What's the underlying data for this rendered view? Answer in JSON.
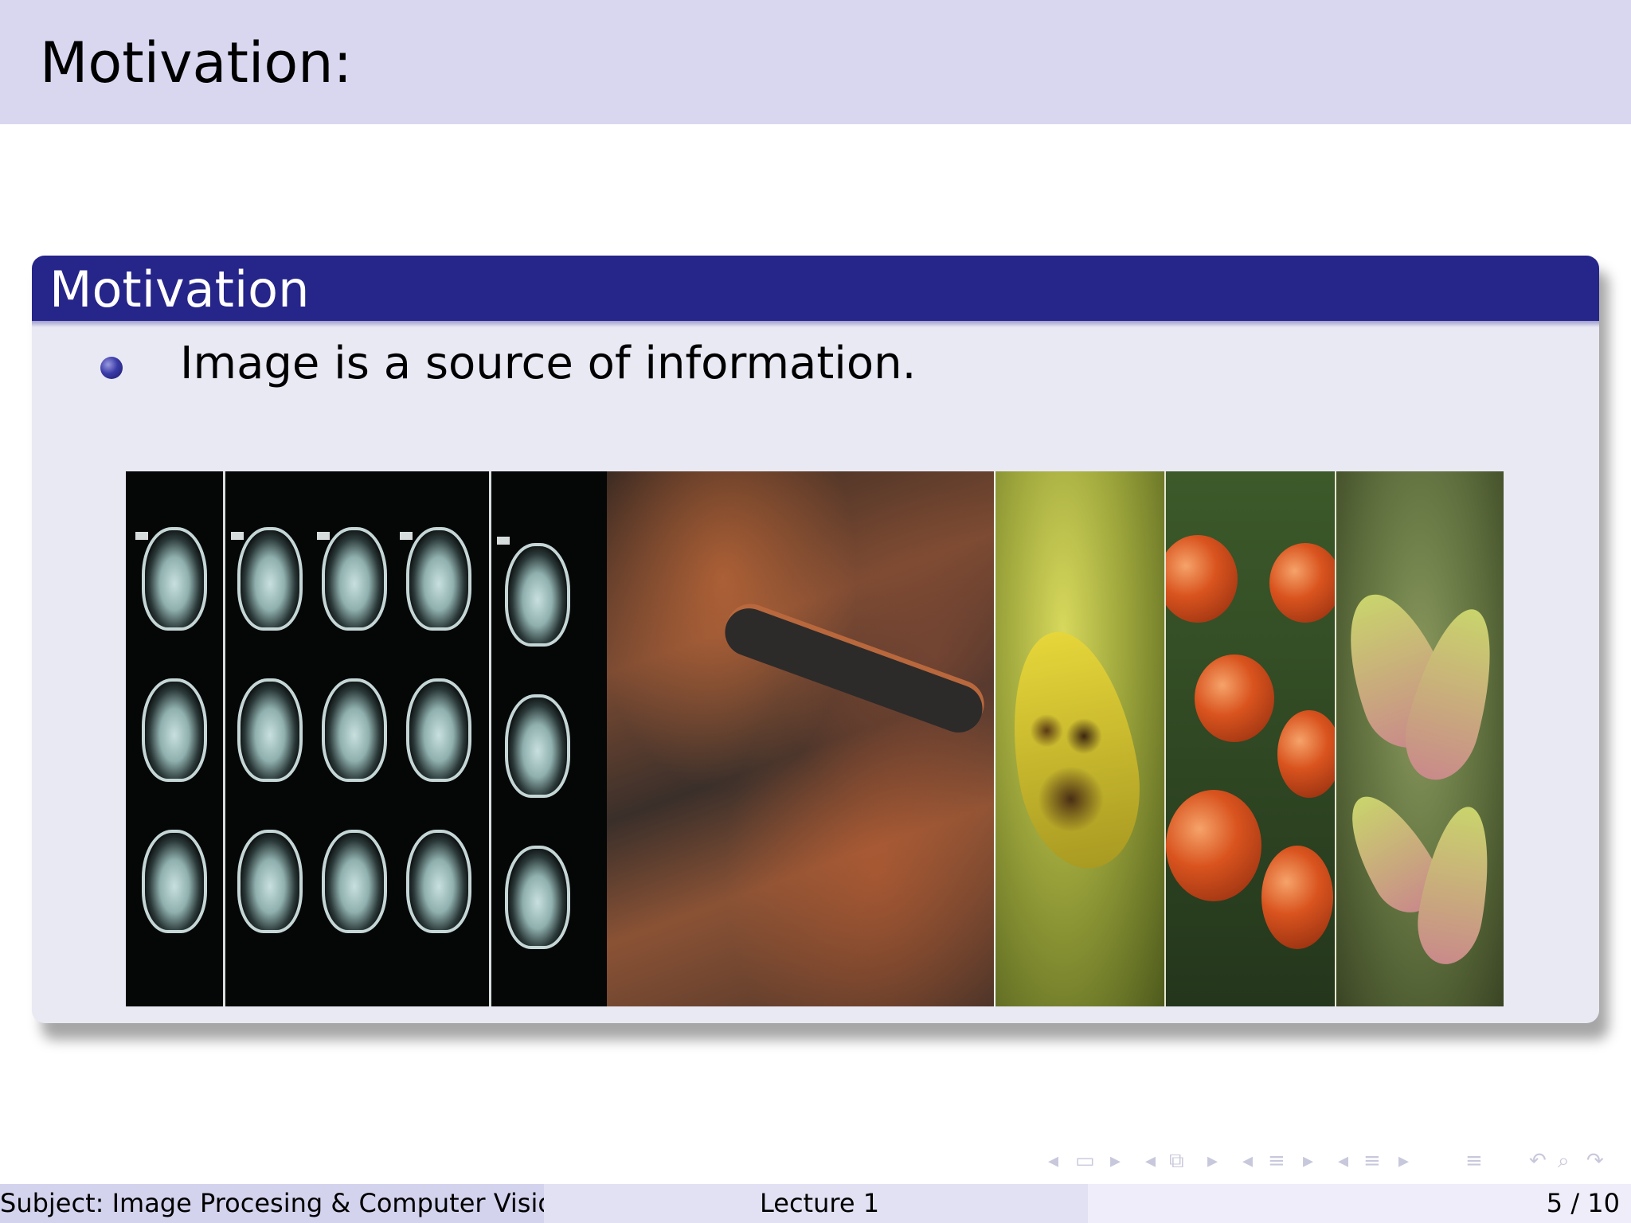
{
  "frame": {
    "title": "Motivation:"
  },
  "block": {
    "title": "Motivation",
    "bullets": [
      "Image is a source of information."
    ]
  },
  "figure": {
    "panels": [
      "ct-scans",
      "terrain",
      "leaf-disease",
      "tomato-disease",
      "plant-disease"
    ]
  },
  "navigation": {
    "icons": [
      "nav-prev-frame-icon",
      "nav-frame-icon",
      "nav-next-frame-icon",
      "nav-prev-slide-icon",
      "nav-slide-icon",
      "nav-next-slide-icon",
      "nav-prev-section-icon",
      "nav-section-icon",
      "nav-next-section-icon",
      "nav-prev-subsection-icon",
      "nav-subsection-icon",
      "nav-next-subsection-icon",
      "nav-toc-icon",
      "nav-back-icon",
      "nav-search-icon",
      "nav-forward-icon"
    ]
  },
  "footer": {
    "subject": "Subject: Image Procesing & Computer Vision",
    "lecture": "Lecture 1",
    "page": "5 / 10"
  },
  "colors": {
    "title_bar": "#d9d7f0",
    "block_header": "#26258a",
    "block_body": "#e9e9f4"
  }
}
